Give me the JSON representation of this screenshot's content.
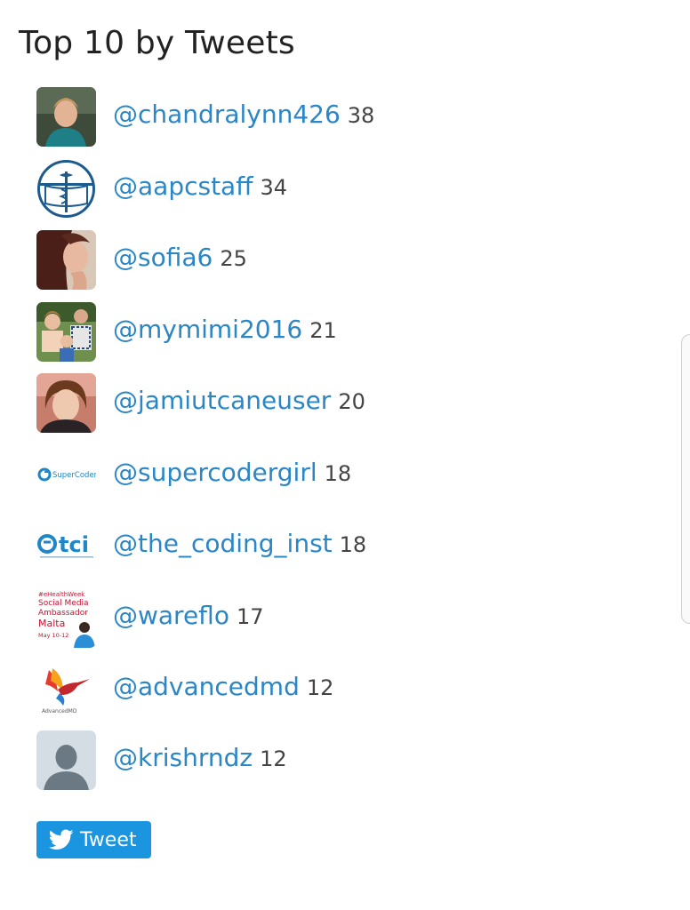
{
  "widget": {
    "title": "Top 10 by Tweets"
  },
  "users": [
    {
      "handle": "@chandralynn426",
      "count": "38",
      "avatar_icon": "person-photo-icon"
    },
    {
      "handle": "@aapcstaff",
      "count": "34",
      "avatar_icon": "medical-caduceus-logo-icon"
    },
    {
      "handle": "@sofia6",
      "count": "25",
      "avatar_icon": "portrait-photo-icon"
    },
    {
      "handle": "@mymimi2016",
      "count": "21",
      "avatar_icon": "family-photo-icon"
    },
    {
      "handle": "@jamiutcaneuser",
      "count": "20",
      "avatar_icon": "person-photo-icon"
    },
    {
      "handle": "@supercodergirl",
      "count": "18",
      "avatar_icon": "supercoder-logo-icon"
    },
    {
      "handle": "@the_coding_inst",
      "count": "18",
      "avatar_icon": "tci-logo-icon"
    },
    {
      "handle": "@wareflo",
      "count": "17",
      "avatar_icon": "ehealthweek-badge-icon"
    },
    {
      "handle": "@advancedmd",
      "count": "12",
      "avatar_icon": "hummingbird-logo-icon"
    },
    {
      "handle": "@krishrndz",
      "count": "12",
      "avatar_icon": "default-user-icon"
    }
  ],
  "tweet_button": {
    "label": "Tweet",
    "icon": "twitter-bird-icon"
  },
  "logo_text": {
    "supercoder": "SuperCoder",
    "tci": "tci",
    "ehealth_lines": [
      "#eHealthWeek",
      "Social Media",
      "Ambassador",
      "Malta",
      "May 10-12"
    ],
    "advancedmd": "AdvancedMD"
  },
  "colors": {
    "link": "#2b86c6",
    "count": "#444444",
    "title": "#222222",
    "tweet_button": "#1b95e0"
  }
}
